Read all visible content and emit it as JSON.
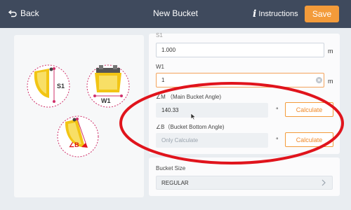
{
  "header": {
    "back_label": "Back",
    "title": "New Bucket",
    "instructions_label": "Instructions",
    "save_label": "Save"
  },
  "fields": {
    "top_partial_label": "S1",
    "top_value": "1.000",
    "top_unit": "m",
    "w1_label": "W1",
    "w1_value": "1",
    "w1_unit": "m",
    "main_angle_label": "∠M （Main Bucket Angle)",
    "main_angle_value": "140.33",
    "main_angle_unit": "°",
    "main_angle_button": "Calculate",
    "bottom_angle_label": "∠B（Bucket Bottom Angle)",
    "bottom_angle_placeholder": "Only Calculate",
    "bottom_angle_unit": "°",
    "bottom_angle_button": "Calculate"
  },
  "bucket_size": {
    "label": "Bucket Size",
    "value": "REGULAR"
  },
  "diagrams": {
    "s1_label": "S1",
    "w1_label": "W1",
    "b_label": "∠B"
  },
  "colors": {
    "header_bg": "#3f4a5d",
    "accent_orange": "#f39b3a",
    "bucket_yellow": "#f2c514",
    "annotation_red": "#e0141c",
    "diagram_magenta": "#d0306a"
  }
}
